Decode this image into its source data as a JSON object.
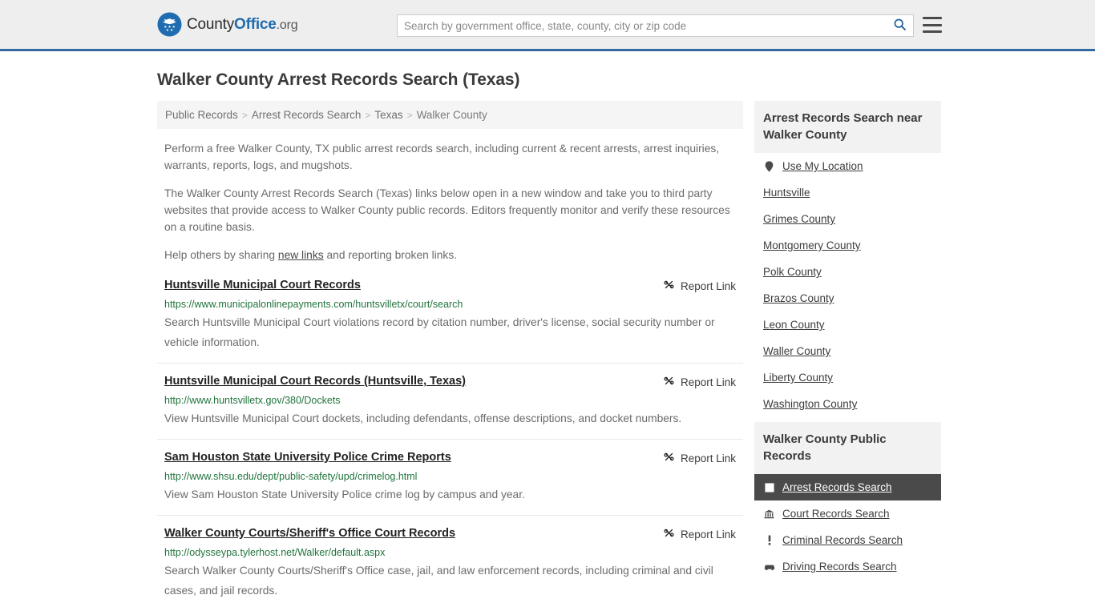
{
  "header": {
    "brand": {
      "county": "County",
      "office": "Office",
      "tld": ".org",
      "logo_icon": "eagle-seal-logo"
    },
    "search": {
      "placeholder": "Search by government office, state, county, city or zip code",
      "value": "",
      "icon": "search-icon"
    },
    "menu_icon": "hamburger-menu-icon",
    "accent_color": "#33699e",
    "background_color": "#eeeeee"
  },
  "page": {
    "title": "Walker County Arrest Records Search (Texas)"
  },
  "breadcrumb": {
    "separator": ">",
    "items": [
      {
        "label": "Public Records"
      },
      {
        "label": "Arrest Records Search"
      },
      {
        "label": "Texas"
      },
      {
        "label": "Walker County"
      }
    ]
  },
  "intro": {
    "p1": "Perform a free Walker County, TX public arrest records search, including current & recent arrests, arrest inquiries, warrants, reports, logs, and mugshots.",
    "p2": "The Walker County Arrest Records Search (Texas) links below open in a new window and take you to third party websites that provide access to Walker County public records. Editors frequently monitor and verify these resources on a routine basis.",
    "p3_before": "Help others by sharing ",
    "p3_link": "new links",
    "p3_after": " and reporting broken links."
  },
  "results": {
    "report_label": "Report Link",
    "report_icon": "broken-link-icon",
    "items": [
      {
        "title": "Huntsville Municipal Court Records",
        "url": "https://www.municipalonlinepayments.com/huntsvilletx/court/search",
        "description": "Search Huntsville Municipal Court violations record by citation number, driver's license, social security number or vehicle information."
      },
      {
        "title": "Huntsville Municipal Court Records (Huntsville, Texas)",
        "url": "http://www.huntsvilletx.gov/380/Dockets",
        "description": "View Huntsville Municipal Court dockets, including defendants, offense descriptions, and docket numbers."
      },
      {
        "title": "Sam Houston State University Police Crime Reports",
        "url": "http://www.shsu.edu/dept/public-safety/upd/crimelog.html",
        "description": "View Sam Houston State University Police crime log by campus and year."
      },
      {
        "title": "Walker County Courts/Sheriff's Office Court Records",
        "url": "http://odysseypa.tylerhost.net/Walker/default.aspx",
        "description": "Search Walker County Courts/Sheriff's Office case, jail, and law enforcement records, including criminal and civil cases, and jail records."
      }
    ]
  },
  "sidebar": {
    "nearby": {
      "heading": "Arrest Records Search near Walker County",
      "items": [
        {
          "label": "Use My Location",
          "icon": "map-pin-icon"
        },
        {
          "label": "Huntsville",
          "icon": ""
        },
        {
          "label": "Grimes County",
          "icon": ""
        },
        {
          "label": "Montgomery County",
          "icon": ""
        },
        {
          "label": "Polk County",
          "icon": ""
        },
        {
          "label": "Brazos County",
          "icon": ""
        },
        {
          "label": "Leon County",
          "icon": ""
        },
        {
          "label": "Waller County",
          "icon": ""
        },
        {
          "label": "Liberty County",
          "icon": ""
        },
        {
          "label": "Washington County",
          "icon": ""
        }
      ]
    },
    "public_records": {
      "heading": "Walker County Public Records",
      "items": [
        {
          "label": "Arrest Records Search",
          "icon": "arrest-card-icon",
          "active": true
        },
        {
          "label": "Court Records Search",
          "icon": "courthouse-icon",
          "active": false
        },
        {
          "label": "Criminal Records Search",
          "icon": "exclamation-icon",
          "active": false
        },
        {
          "label": "Driving Records Search",
          "icon": "car-icon",
          "active": false
        }
      ]
    }
  }
}
